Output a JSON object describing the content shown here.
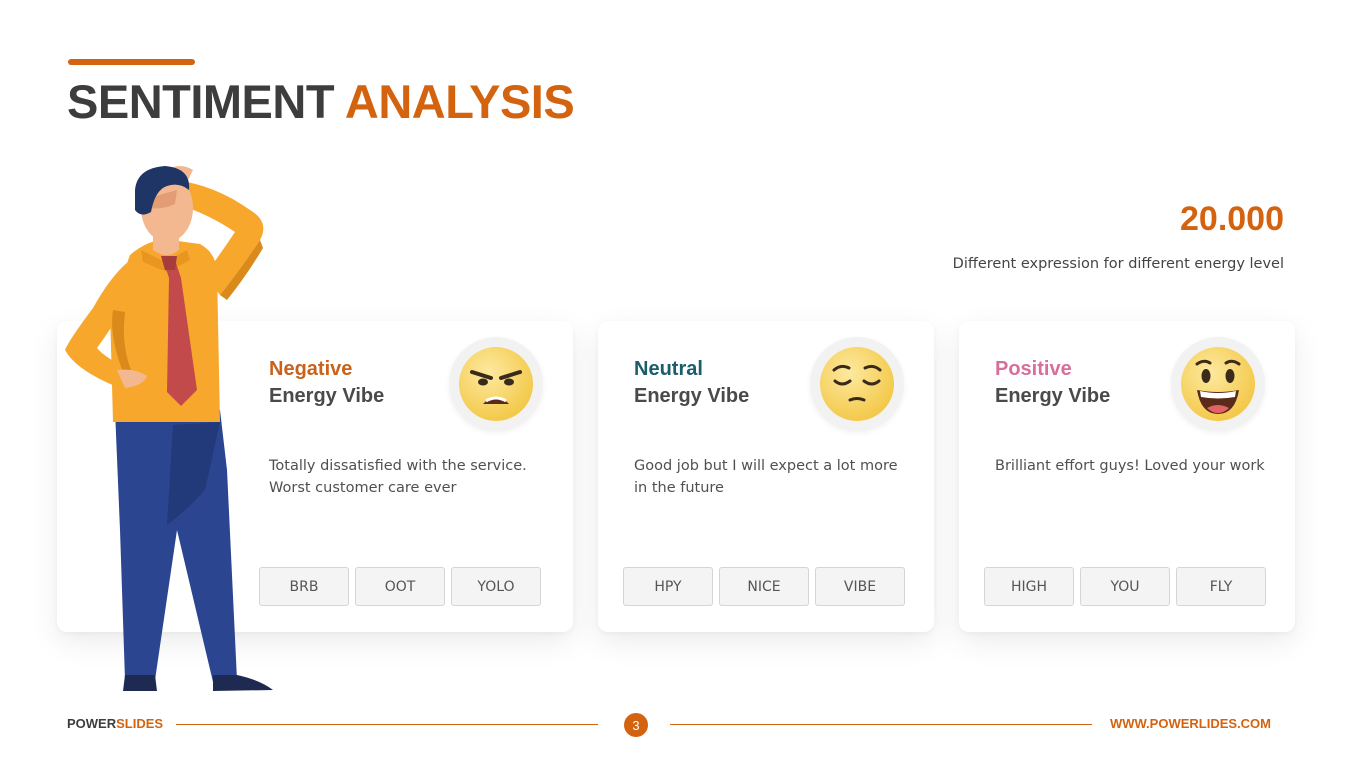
{
  "title": {
    "word1": "SENTIMENT",
    "word2": "ANALYSIS"
  },
  "stat": {
    "value": "20.000",
    "caption": "Different expression for different energy level"
  },
  "cards": [
    {
      "title": "Negative",
      "subtitle": "Energy Vibe",
      "title_color": "#c8621c",
      "description": "Totally dissatisfied with the service. Worst customer care ever",
      "emoji": "angry-face-icon",
      "tags": [
        "BRB",
        "OOT",
        "YOLO"
      ]
    },
    {
      "title": "Neutral",
      "subtitle": "Energy Vibe",
      "title_color": "#1c5d6b",
      "description": "Good job but I will expect a lot more in the future",
      "emoji": "relieved-face-icon",
      "tags": [
        "HPY",
        "NICE",
        "VIBE"
      ]
    },
    {
      "title": "Positive",
      "subtitle": "Energy Vibe",
      "title_color": "#d76f9b",
      "description": "Brilliant effort guys! Loved your work",
      "emoji": "grinning-face-icon",
      "tags": [
        "HIGH",
        "YOU",
        "FLY"
      ]
    }
  ],
  "footer": {
    "brand_part1": "POWER",
    "brand_part2": "SLIDES",
    "page_number": "3",
    "url": "WWW.POWERLIDES.COM"
  },
  "colors": {
    "accent": "#d4630f",
    "dark_text": "#3d3d3d"
  }
}
